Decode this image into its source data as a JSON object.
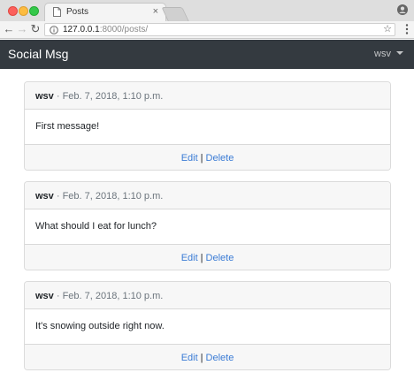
{
  "browser": {
    "tab_title": "Posts",
    "tab_close": "×",
    "url_host": "127.0.0.1",
    "url_rest": ":8000/posts/"
  },
  "navbar": {
    "brand": "Social Msg",
    "user": "wsv"
  },
  "posts": [
    {
      "author": "wsv",
      "separator": " · ",
      "timestamp": "Feb. 7, 2018, 1:10 p.m.",
      "body": "First message!",
      "edit_label": "Edit",
      "pipe": "|",
      "delete_label": "Delete"
    },
    {
      "author": "wsv",
      "separator": " · ",
      "timestamp": "Feb. 7, 2018, 1:10 p.m.",
      "body": "What should I eat for lunch?",
      "edit_label": "Edit",
      "pipe": "|",
      "delete_label": "Delete"
    },
    {
      "author": "wsv",
      "separator": " · ",
      "timestamp": "Feb. 7, 2018, 1:10 p.m.",
      "body": "It's snowing outside right now.",
      "edit_label": "Edit",
      "pipe": "|",
      "delete_label": "Delete"
    }
  ],
  "icons": {
    "tab_page": "page-icon",
    "profile": "profile-icon",
    "back": "back-arrow-icon",
    "forward": "forward-arrow-icon",
    "reload": "reload-icon",
    "info": "info-icon",
    "bookmark": "star-icon",
    "menu": "menu-dots-icon"
  },
  "colors": {
    "navbar_bg": "#343a40",
    "link": "#3a7bd5",
    "card_header_bg": "#f7f7f7"
  }
}
